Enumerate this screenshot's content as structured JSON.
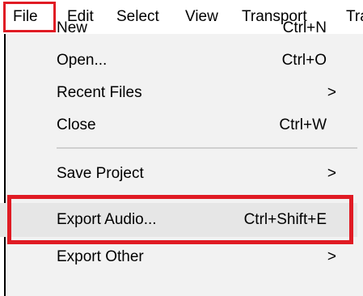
{
  "menubar": {
    "items": [
      "File",
      "Edit",
      "Select",
      "View",
      "Transport",
      "Trac"
    ]
  },
  "file_menu": {
    "items": [
      {
        "label": "New",
        "shortcut": "Ctrl+N"
      },
      {
        "label": "Open...",
        "shortcut": "Ctrl+O"
      },
      {
        "label": "Recent Files",
        "submenu_arrow": ">"
      },
      {
        "label": "Close",
        "shortcut": "Ctrl+W"
      },
      {
        "label": "Save Project",
        "submenu_arrow": ">"
      },
      {
        "label": "Export Audio...",
        "shortcut": "Ctrl+Shift+E"
      },
      {
        "label": "Export Other",
        "submenu_arrow": ">"
      }
    ]
  },
  "colors": {
    "highlight_box": "#e01b24",
    "menu_background": "#f2f2f2",
    "hovered_item": "#e6e6e6"
  }
}
